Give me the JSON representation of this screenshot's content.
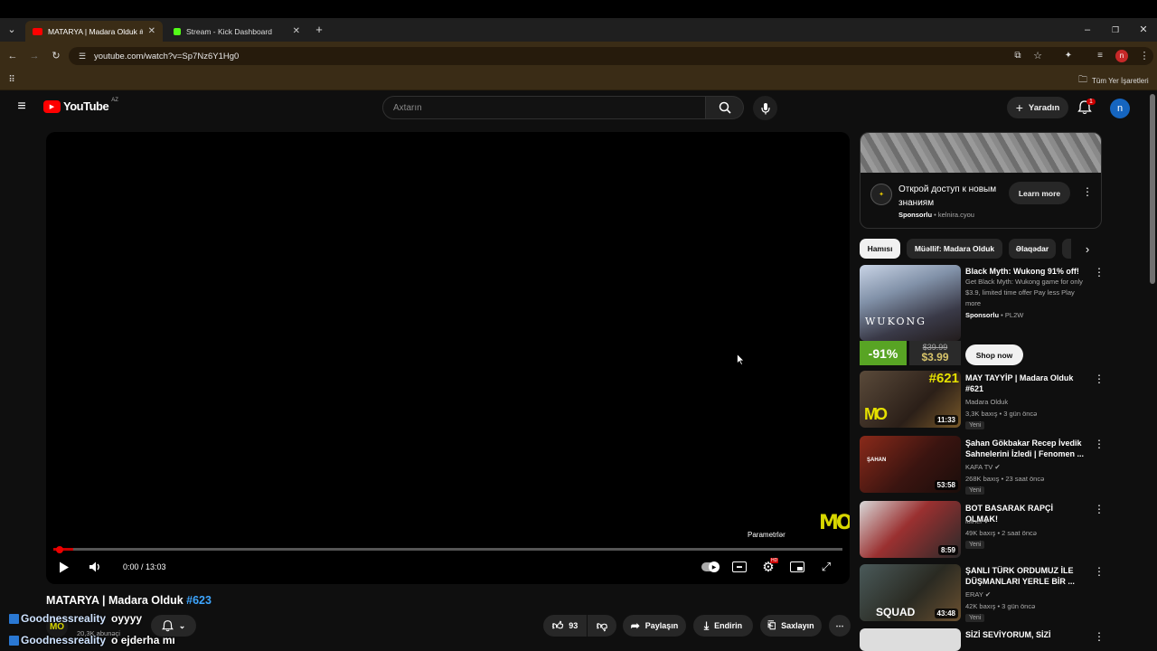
{
  "browser": {
    "tabs": [
      {
        "title": "MATARYA | Madara Olduk #623",
        "favicon_color": "#ff0000",
        "active": true
      },
      {
        "title": "Stream - Kick Dashboard",
        "favicon_color": "#53fc18",
        "active": false
      }
    ],
    "url": "youtube.com/watch?v=Sp7Nz6Y1Hg0",
    "profile_initial": "n",
    "bookmarks_label": "Tüm Yer İşaretleri"
  },
  "youtube": {
    "logo_text": "YouTube",
    "region": "AZ",
    "search_placeholder": "Axtarın",
    "create_label": "Yaradın",
    "notification_count": "1",
    "avatar_initial": "n"
  },
  "player": {
    "time": "0:00 / 13:03",
    "progress_fraction": 0.0,
    "settings_tooltip": "Parametrlər",
    "watermark": "MO"
  },
  "video": {
    "title": "MATARYA | Madara Olduk",
    "hashtag": "#623",
    "channel_logo": "MO",
    "subscribers": "20,3K abunəçi",
    "likes": "93",
    "share_label": "Paylaşın",
    "download_label": "Endirin",
    "save_label": "Saxlayın"
  },
  "chat_overlay": [
    {
      "user": "Goodnessreality",
      "message": "oyyyy"
    },
    {
      "user": "Goodnessreality",
      "message": "o ejderha mı"
    }
  ],
  "ad": {
    "title": "Открой доступ к новым знаниям",
    "sponsored": "Sponsorlu",
    "domain": "kelnira.cyou",
    "button": "Learn more"
  },
  "chips": [
    "Hamısı",
    "Müəllif: Madara Olduk",
    "Əlaqədar"
  ],
  "recommendations": [
    {
      "title": "Black Myth: Wukong 91% off!",
      "description": "Get Black Myth: Wukong game for only $3.9, limited time offer Pay less Play more",
      "sponsor": "Sponsorlu",
      "advertiser": "PL2W",
      "discount": "-91%",
      "old_price": "$39.99",
      "new_price": "$3.99",
      "thumb_text": "WUKONG",
      "button": "Shop now"
    },
    {
      "title": "MAY TAYYİP | Madara Olduk #621",
      "channel": "Madara Olduk",
      "meta": "3,3K baxış • 3 gün öncə",
      "badge": "Yeni",
      "duration": "11:33",
      "thumb_text": "#621"
    },
    {
      "title": "Şahan Gökbakar Recep İvedik Sahnelerini İzledi | Fenomen ...",
      "channel": "KAFA TV",
      "meta": "268K baxış • 23 saat öncə",
      "badge": "Yeni",
      "duration": "53:58",
      "thumb_text": "ŞAHAN"
    },
    {
      "title": "BOT BASARAK RAPÇİ OLMAK!",
      "channel": "luther",
      "meta": "49K baxış • 2 saat öncə",
      "badge": "Yeni",
      "duration": "8:59",
      "thumb_text": ""
    },
    {
      "title": "ŞANLI TÜRK ORDUMUZ İLE DÜŞMANLARI YERLE BİR ...",
      "channel": "ERAY",
      "meta": "42K baxış • 3 gün öncə",
      "badge": "Yeni",
      "duration": "43:48",
      "thumb_text": "SQUAD"
    },
    {
      "title": "SİZİ SEVİYORUM, SİZİ"
    }
  ]
}
